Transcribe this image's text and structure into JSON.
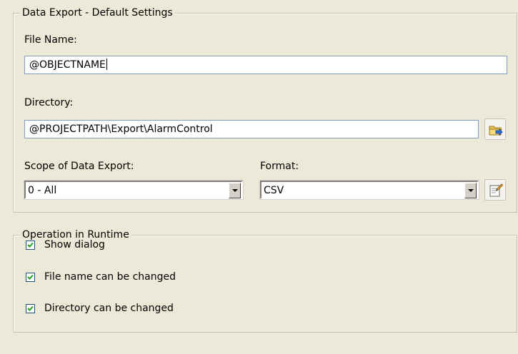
{
  "export_group": {
    "title": "Data Export - Default Settings",
    "file_name_label": "File Name:",
    "file_name_value": "@OBJECTNAME",
    "directory_label": "Directory:",
    "directory_value": "@PROJECTPATH\\Export\\AlarmControl",
    "scope_label": "Scope of Data Export:",
    "scope_value": "0 - All",
    "format_label": "Format:",
    "format_value": "CSV",
    "browse_icon": "folder-browse-icon",
    "format_settings_icon": "format-settings-icon"
  },
  "runtime_group": {
    "title": "Operation in Runtime",
    "options": [
      {
        "label": "Show dialog",
        "checked": true
      },
      {
        "label": "File name can be changed",
        "checked": true
      },
      {
        "label": "Directory can be changed",
        "checked": true
      }
    ]
  }
}
